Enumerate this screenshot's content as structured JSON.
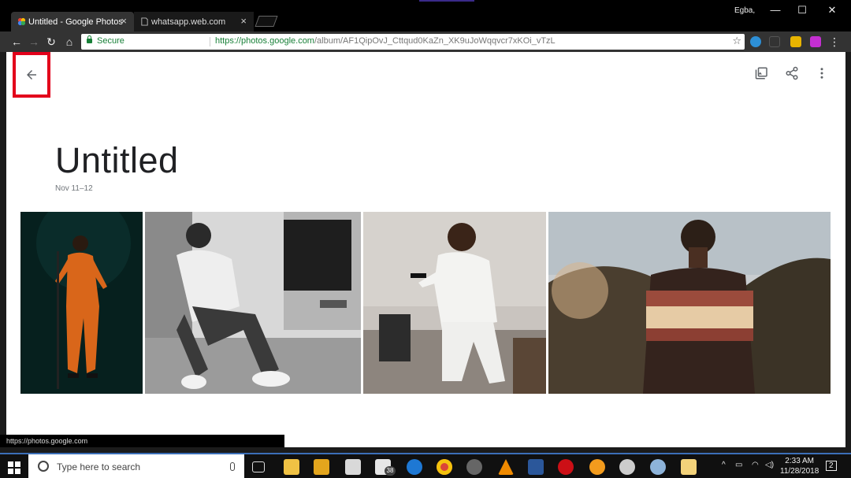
{
  "browser": {
    "user_name": "Egba,",
    "tabs": [
      {
        "title": "Untitled - Google Photos",
        "close": "×",
        "active": true
      },
      {
        "title": "whatsapp.web.com",
        "close": "×",
        "active": false
      }
    ],
    "window_controls": {
      "minimize": "—",
      "maximize": "☐",
      "close": "✕"
    },
    "nav": {
      "back": "←",
      "forward": "→",
      "reload": "↻",
      "home": "⌂"
    },
    "omnibox": {
      "secure_label": "Secure",
      "url_host": "https://photos.google.com",
      "url_path": "/album/AF1QipOvJ_Cttqud0KaZn_XK9uJoWqqvcr7xKOi_vTzL",
      "star": "☆"
    },
    "menu": "⋮",
    "status_url": "https://photos.google.com"
  },
  "album": {
    "title": "Untitled",
    "date_range": "Nov 11–12",
    "photos": [
      {
        "name": "photo-orange-jumpsuit-singer"
      },
      {
        "name": "photo-bw-man-sitting-floor"
      },
      {
        "name": "photo-white-outfit-sunglasses"
      },
      {
        "name": "photo-striped-sweater-outdoors"
      }
    ]
  },
  "taskbar": {
    "search_placeholder": "Type here to search",
    "mail_badge": "38",
    "clock_time": "2:33 AM",
    "clock_date": "11/28/2018",
    "notification_count": "2"
  },
  "colors": {
    "highlight_box": "#e3001b",
    "secure_green": "#188038",
    "taskbar_accent": "#3b6fb8"
  }
}
